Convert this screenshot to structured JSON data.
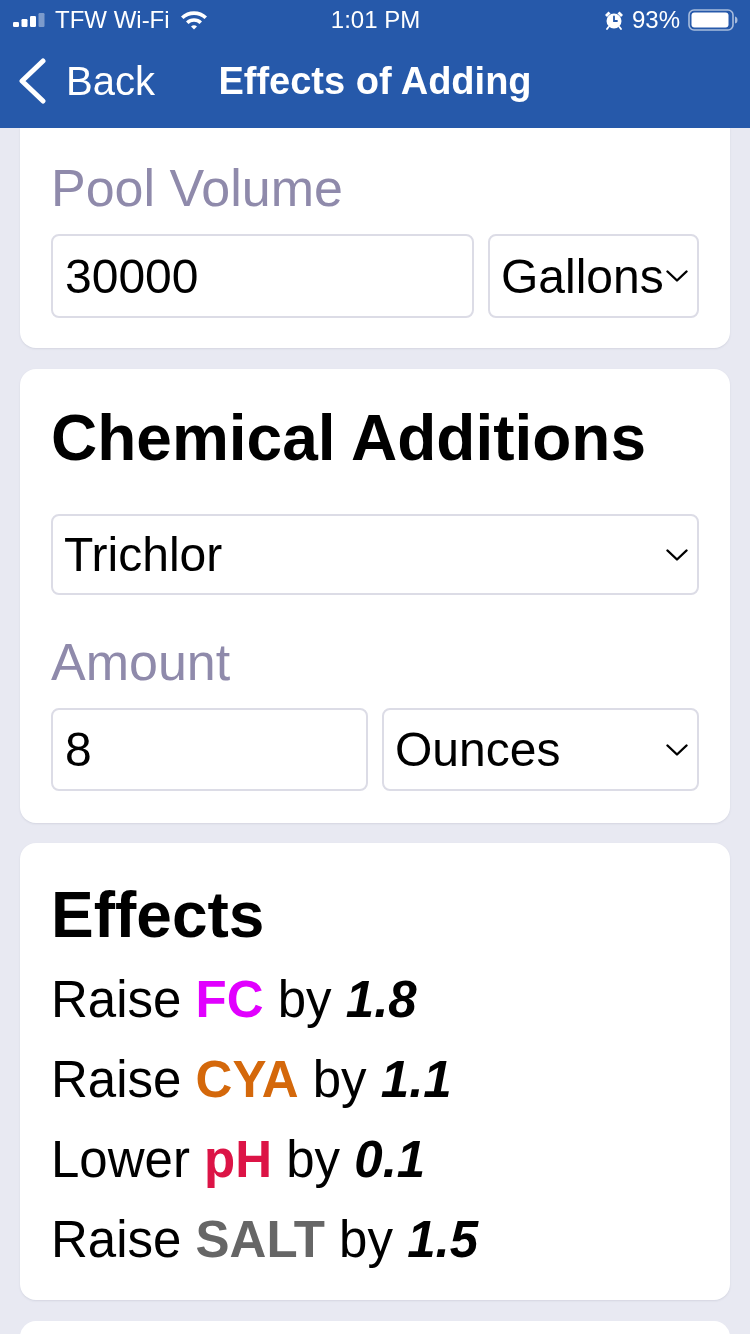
{
  "status_bar": {
    "carrier": "TFW Wi-Fi",
    "time": "1:01 PM",
    "battery": "93%"
  },
  "nav_bar": {
    "back": "Back",
    "title": "Effects of Adding"
  },
  "pool_volume": {
    "label": "Pool Volume",
    "value": "30000",
    "unit": "Gallons"
  },
  "chemical_additions": {
    "title": "Chemical Additions",
    "chemical": "Trichlor",
    "amount_label": "Amount",
    "amount": "8",
    "amount_unit": "Ounces"
  },
  "effects": {
    "title": "Effects",
    "items": [
      {
        "verb": "Raise",
        "parameter": "FC",
        "color": "#e100ff",
        "preposition": "by",
        "amount": "1.8"
      },
      {
        "verb": "Raise",
        "parameter": "CYA",
        "color": "#d4680b",
        "preposition": "by",
        "amount": "1.1"
      },
      {
        "verb": "Lower",
        "parameter": "pH",
        "color": "#dc1446",
        "preposition": "by",
        "amount": "0.1"
      },
      {
        "verb": "Raise",
        "parameter": "SALT",
        "color": "#666666",
        "preposition": "by",
        "amount": "1.5"
      }
    ]
  }
}
